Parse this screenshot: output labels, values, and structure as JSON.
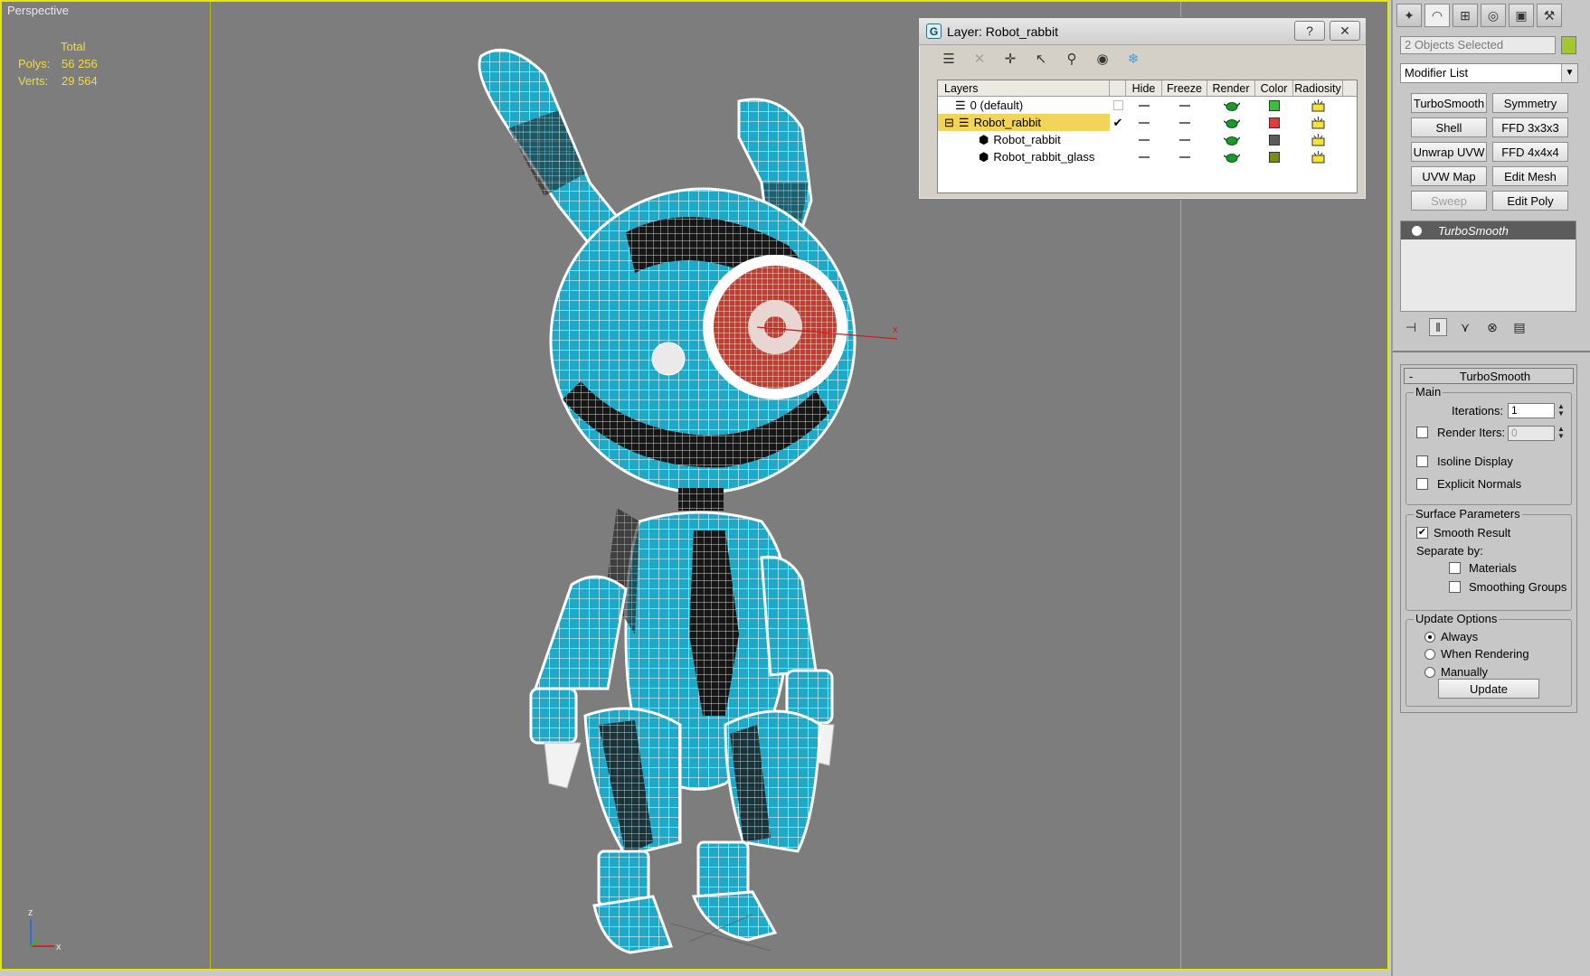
{
  "viewport": {
    "label": "Perspective",
    "stats": {
      "header": "Total",
      "polys_label": "Polys:",
      "polys_value": "56 256",
      "verts_label": "Verts:",
      "verts_value": "29 564"
    },
    "axis": {
      "z": "z",
      "x": "x",
      "gizmo_x": "x"
    }
  },
  "layer_dialog": {
    "title": "Layer: Robot_rabbit",
    "help": "?",
    "close": "✕",
    "columns": [
      "Layers",
      "",
      "Hide",
      "Freeze",
      "Render",
      "Color",
      "Radiosity"
    ],
    "rows": [
      {
        "name": "0 (default)",
        "type": "layer",
        "current": "",
        "color": "#35c435"
      },
      {
        "name": "Robot_rabbit",
        "type": "layer",
        "expand": "⊟",
        "current": "✔",
        "color": "#e43a3a",
        "selected": true
      },
      {
        "name": "Robot_rabbit",
        "type": "object",
        "current": "",
        "color": "#5a5a5a"
      },
      {
        "name": "Robot_rabbit_glass",
        "type": "object",
        "current": "",
        "color": "#7d8a15"
      }
    ]
  },
  "command_panel": {
    "selection": "2 Objects Selected",
    "selection_color": "#a2c82e",
    "modifier_list": "Modifier List",
    "modifier_buttons": [
      {
        "label": "TurboSmooth"
      },
      {
        "label": "Symmetry"
      },
      {
        "label": "Shell"
      },
      {
        "label": "FFD 3x3x3"
      },
      {
        "label": "Unwrap UVW"
      },
      {
        "label": "FFD 4x4x4"
      },
      {
        "label": "UVW Map"
      },
      {
        "label": "Edit Mesh"
      },
      {
        "label": "Sweep",
        "disabled": true
      },
      {
        "label": "Edit Poly"
      }
    ],
    "stack_item": "TurboSmooth",
    "rollout": {
      "minus": "-",
      "title": "TurboSmooth",
      "main_group": "Main",
      "iterations_label": "Iterations:",
      "iterations_value": "1",
      "render_iters_label": "Render Iters:",
      "render_iters_value": "0",
      "isoline_label": "Isoline Display",
      "explicit_normals_label": "Explicit Normals",
      "surface_group": "Surface Parameters",
      "smooth_result_label": "Smooth Result",
      "smooth_result_check": "✔",
      "separate_by_label": "Separate by:",
      "materials_label": "Materials",
      "smoothing_groups_label": "Smoothing Groups",
      "update_group": "Update Options",
      "always_label": "Always",
      "when_rendering_label": "When Rendering",
      "manually_label": "Manually",
      "update_button": "Update"
    }
  }
}
